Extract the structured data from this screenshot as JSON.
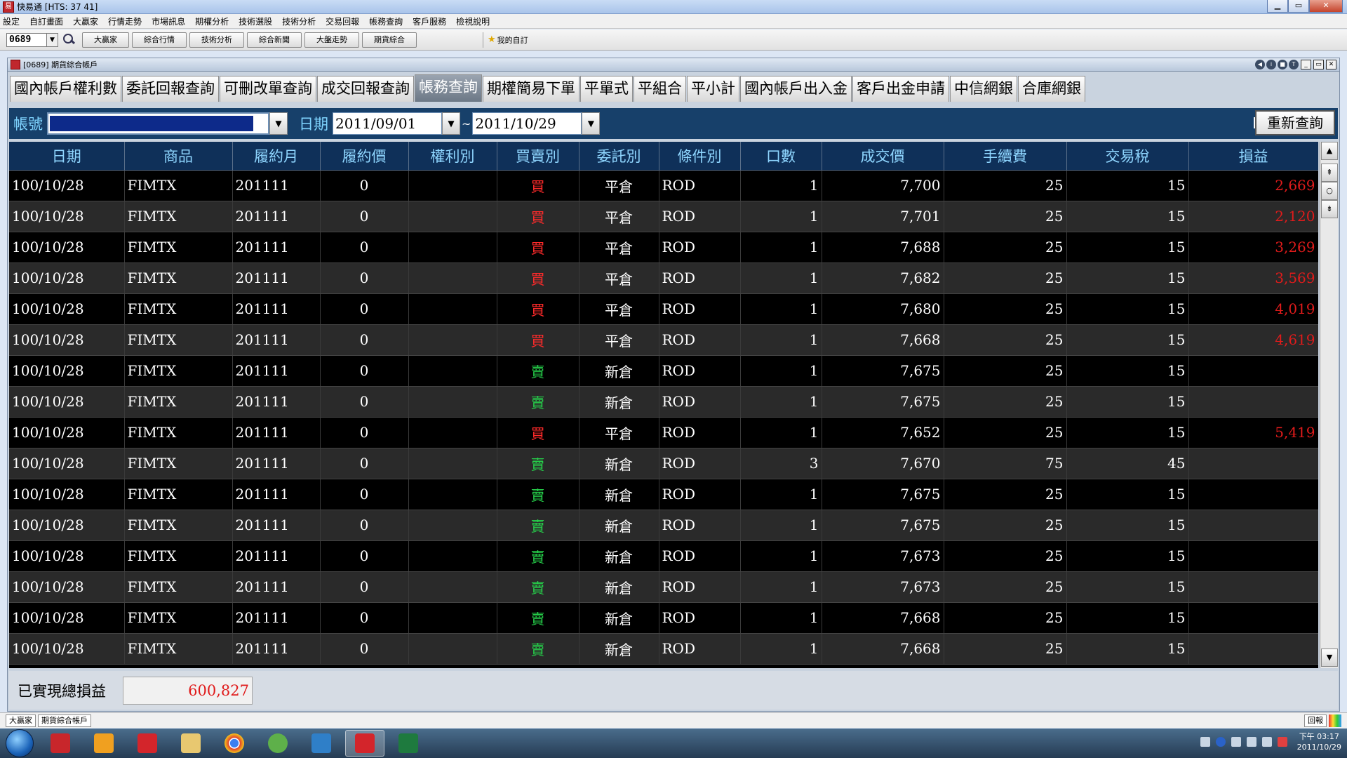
{
  "window": {
    "title": "快易通 [HTS: 37 41]"
  },
  "menu": [
    "設定",
    "自訂畫面",
    "大贏家",
    "行情走勢",
    "市場訊息",
    "期權分析",
    "技術選股",
    "技術分析",
    "交易回報",
    "帳務查詢",
    "客戶服務",
    "檢視說明"
  ],
  "toolbar": {
    "code": "0689",
    "buttons": [
      "大贏家",
      "綜合行情",
      "技術分析",
      "綜合新聞",
      "大盤走勢",
      "期貨綜合"
    ],
    "favorites": "我的自訂"
  },
  "inner": {
    "title": "[0689] 期貨綜合帳戶"
  },
  "tabs": [
    {
      "label": "國內帳戶權利數",
      "active": false
    },
    {
      "label": "委託回報查詢",
      "active": false
    },
    {
      "label": "可刪改單查詢",
      "active": false
    },
    {
      "label": "成交回報查詢",
      "active": false
    },
    {
      "label": "帳務查詢",
      "active": true
    },
    {
      "label": "期權簡易下單",
      "active": false
    },
    {
      "label": "平單式",
      "active": false
    },
    {
      "label": "平組合",
      "active": false
    },
    {
      "label": "平小計",
      "active": false
    },
    {
      "label": "國內帳戶出入金",
      "active": false
    },
    {
      "label": "客戶出金申請",
      "active": false
    },
    {
      "label": "中信網銀",
      "active": false
    },
    {
      "label": "合庫網銀",
      "active": false
    }
  ],
  "filter": {
    "account_label": "帳號",
    "date_label": "日期",
    "date_from": "2011/09/01",
    "tilde": "~",
    "date_to": "2011/10/29",
    "requery": "重新查詢"
  },
  "table": {
    "columns": [
      "日期",
      "商品",
      "履約月",
      "履約價",
      "權利別",
      "買賣別",
      "委託別",
      "條件別",
      "口數",
      "成交價",
      "手續費",
      "交易稅",
      "損益"
    ],
    "rows": [
      [
        "100/10/28",
        "FIMTX",
        "201111",
        "0",
        "",
        "買",
        "平倉",
        "ROD",
        "1",
        "7,700",
        "25",
        "15",
        "2,669"
      ],
      [
        "100/10/28",
        "FIMTX",
        "201111",
        "0",
        "",
        "買",
        "平倉",
        "ROD",
        "1",
        "7,701",
        "25",
        "15",
        "2,120"
      ],
      [
        "100/10/28",
        "FIMTX",
        "201111",
        "0",
        "",
        "買",
        "平倉",
        "ROD",
        "1",
        "7,688",
        "25",
        "15",
        "3,269"
      ],
      [
        "100/10/28",
        "FIMTX",
        "201111",
        "0",
        "",
        "買",
        "平倉",
        "ROD",
        "1",
        "7,682",
        "25",
        "15",
        "3,569"
      ],
      [
        "100/10/28",
        "FIMTX",
        "201111",
        "0",
        "",
        "買",
        "平倉",
        "ROD",
        "1",
        "7,680",
        "25",
        "15",
        "4,019"
      ],
      [
        "100/10/28",
        "FIMTX",
        "201111",
        "0",
        "",
        "買",
        "平倉",
        "ROD",
        "1",
        "7,668",
        "25",
        "15",
        "4,619"
      ],
      [
        "100/10/28",
        "FIMTX",
        "201111",
        "0",
        "",
        "賣",
        "新倉",
        "ROD",
        "1",
        "7,675",
        "25",
        "15",
        ""
      ],
      [
        "100/10/28",
        "FIMTX",
        "201111",
        "0",
        "",
        "賣",
        "新倉",
        "ROD",
        "1",
        "7,675",
        "25",
        "15",
        ""
      ],
      [
        "100/10/28",
        "FIMTX",
        "201111",
        "0",
        "",
        "買",
        "平倉",
        "ROD",
        "1",
        "7,652",
        "25",
        "15",
        "5,419"
      ],
      [
        "100/10/28",
        "FIMTX",
        "201111",
        "0",
        "",
        "賣",
        "新倉",
        "ROD",
        "3",
        "7,670",
        "75",
        "45",
        ""
      ],
      [
        "100/10/28",
        "FIMTX",
        "201111",
        "0",
        "",
        "賣",
        "新倉",
        "ROD",
        "1",
        "7,675",
        "25",
        "15",
        ""
      ],
      [
        "100/10/28",
        "FIMTX",
        "201111",
        "0",
        "",
        "賣",
        "新倉",
        "ROD",
        "1",
        "7,675",
        "25",
        "15",
        ""
      ],
      [
        "100/10/28",
        "FIMTX",
        "201111",
        "0",
        "",
        "賣",
        "新倉",
        "ROD",
        "1",
        "7,673",
        "25",
        "15",
        ""
      ],
      [
        "100/10/28",
        "FIMTX",
        "201111",
        "0",
        "",
        "賣",
        "新倉",
        "ROD",
        "1",
        "7,673",
        "25",
        "15",
        ""
      ],
      [
        "100/10/28",
        "FIMTX",
        "201111",
        "0",
        "",
        "賣",
        "新倉",
        "ROD",
        "1",
        "7,668",
        "25",
        "15",
        ""
      ],
      [
        "100/10/28",
        "FIMTX",
        "201111",
        "0",
        "",
        "賣",
        "新倉",
        "ROD",
        "1",
        "7,668",
        "25",
        "15",
        ""
      ]
    ]
  },
  "summary": {
    "label": "已實現總損益",
    "value": "600,827"
  },
  "statusbar": {
    "items": [
      "大贏家",
      "期貨綜合帳戶"
    ],
    "report": "回報"
  },
  "clock": {
    "time": "下午 03:17",
    "date": "2011/10/29"
  },
  "colors": {
    "buy": "#ff2a2a",
    "sell": "#26d04a",
    "pnl": "#e01b1b",
    "header_bg": "#0f3059",
    "filter_bg": "#17406a"
  }
}
